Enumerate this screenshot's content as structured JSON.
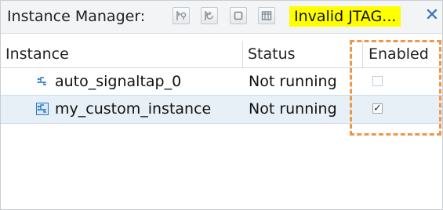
{
  "toolbar": {
    "title": "Instance Manager:",
    "buttons": [
      {
        "name": "run-analysis-button-icon"
      },
      {
        "name": "autorun-analysis-button-icon"
      },
      {
        "name": "stop-analysis-button-icon"
      },
      {
        "name": "read-data-button-icon"
      }
    ],
    "status_warning": "Invalid JTAG...",
    "status_warning_color": "#ffff00",
    "close_glyph": "✕",
    "accent_color": "#2c6fb5"
  },
  "table": {
    "columns": [
      "Instance",
      "Status",
      "Enabled"
    ],
    "rows": [
      {
        "icon": "signaltap-instance-icon",
        "instance": "auto_signaltap_0",
        "status": "Not running",
        "enabled": false,
        "selected": false
      },
      {
        "icon": "signaltap-instance-icon",
        "instance": "my_custom_instance",
        "status": "Not running",
        "enabled": true,
        "selected": true
      }
    ],
    "check_glyph": "✓"
  },
  "annotation": {
    "color": "#f0964a",
    "style": "dashed"
  }
}
